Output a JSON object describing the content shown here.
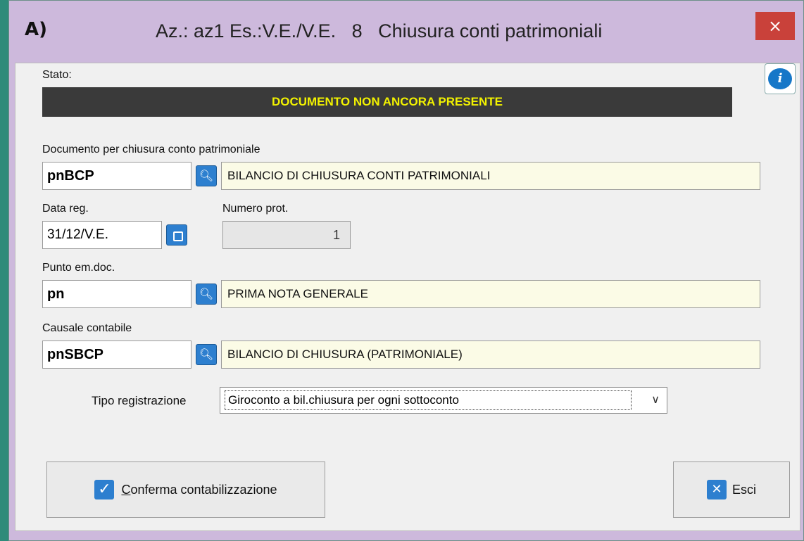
{
  "window": {
    "title": "Az.: az1 Es.:V.E./V.E.   8   Chiusura conti patrimoniali",
    "close_glyph": "×"
  },
  "stato": {
    "label": "Stato:",
    "value": "DOCUMENTO NON ANCORA PRESENTE"
  },
  "documento": {
    "label": "Documento per chiusura conto patrimoniale",
    "code": "pnBCP",
    "description": "BILANCIO DI CHIUSURA CONTI PATRIMONIALI"
  },
  "data_reg": {
    "label": "Data reg.",
    "value": "31/12/V.E."
  },
  "numero_prot": {
    "label": "Numero prot.",
    "value": "1"
  },
  "punto": {
    "label": "Punto em.doc.",
    "code": "pn",
    "description": "PRIMA NOTA GENERALE"
  },
  "causale": {
    "label": "Causale contabile",
    "code": "pnSBCP",
    "description": "BILANCIO DI CHIUSURA (PATRIMONIALE)"
  },
  "tipo": {
    "label": "Tipo registrazione",
    "selected": "Giroconto a bil.chiusura per ogni sottoconto"
  },
  "buttons": {
    "confirm_first": "C",
    "confirm_rest": "onferma contabilizzazione",
    "exit": "Esci"
  },
  "icons": {
    "app": "app-logo-icon",
    "info": "info-icon",
    "lookup": "magnifier-icon",
    "calendar": "calendar-icon",
    "confirm": "checkmark-icon",
    "exit": "close-icon"
  },
  "colors": {
    "title_bg": "#cdb9dc",
    "status_bg": "#3a3a3a",
    "status_text": "#f2f200",
    "accent": "#2d7fcf",
    "close": "#c9413a"
  }
}
